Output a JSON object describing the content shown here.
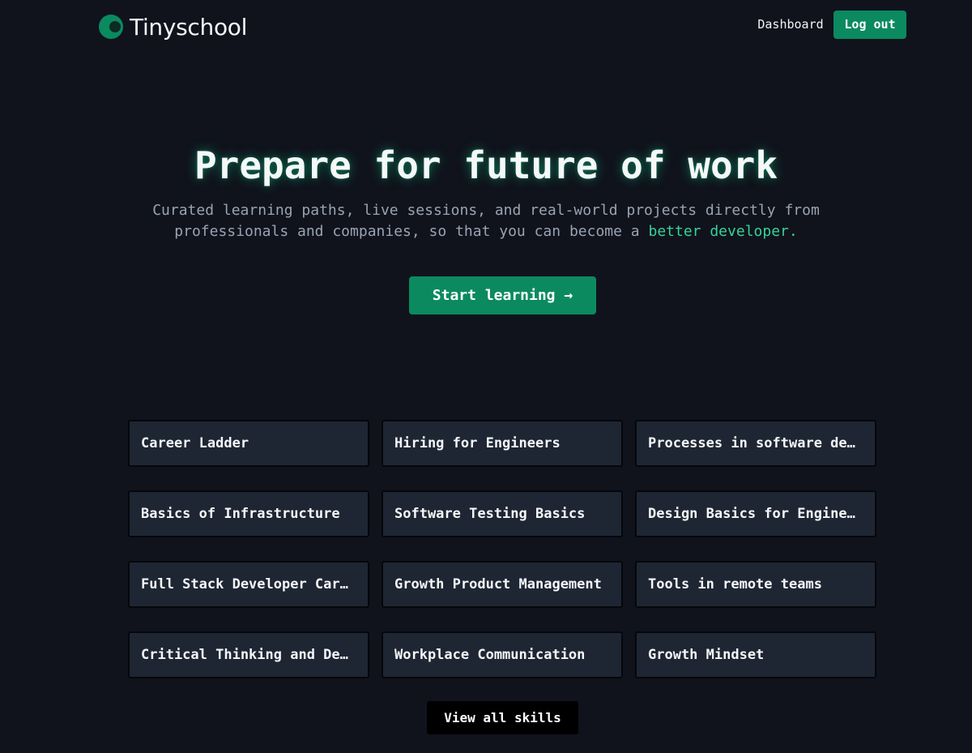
{
  "header": {
    "logo_text": "Tinyschool",
    "logo_icon": "circle-logo-icon",
    "nav_dashboard": "Dashboard",
    "nav_logout": "Log out"
  },
  "hero": {
    "title": "Prepare for future of work",
    "subtitle_text": "Curated learning paths, live sessions, and real-world projects directly from professionals and companies, so that you can become a ",
    "subtitle_accent": "better developer.",
    "cta_label": "Start learning →"
  },
  "skills": [
    "Career Ladder",
    "Hiring for Engineers",
    "Processes in software development",
    "Basics of Infrastructure",
    "Software Testing Basics",
    "Design Basics for Engineers",
    "Full Stack Developer Career",
    "Growth Product Management",
    "Tools in remote teams",
    "Critical Thinking and Decision Making",
    "Workplace Communication",
    "Growth Mindset"
  ],
  "view_all_label": "View all skills",
  "colors": {
    "background": "#10131c",
    "accent": "#0b8a60",
    "accent_text": "#36d399",
    "card": "#1f2633"
  }
}
